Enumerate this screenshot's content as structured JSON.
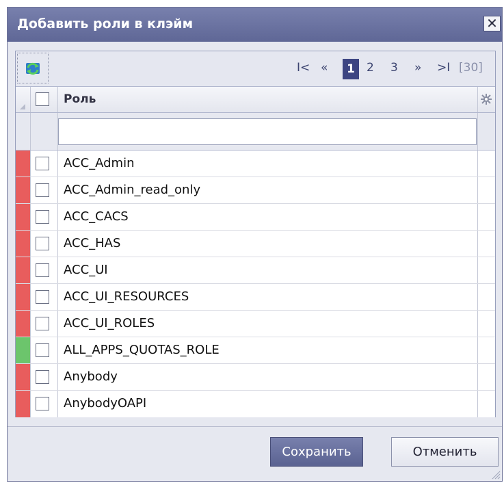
{
  "dialog": {
    "title": "Добавить роли в клэйм",
    "close_glyph": "✕"
  },
  "toolbar": {
    "refresh_icon": "refresh-icon",
    "pager": {
      "first": "I<",
      "prev": "«",
      "pages": [
        "1",
        "2",
        "3"
      ],
      "current_page": "1",
      "next": "»",
      "last": ">I",
      "total": "[30]"
    }
  },
  "grid": {
    "column_title": "Роль",
    "filter_value": "",
    "rows": [
      {
        "label": "ACC_Admin",
        "status_color": "#e85d5d"
      },
      {
        "label": "ACC_Admin_read_only",
        "status_color": "#e85d5d"
      },
      {
        "label": "ACC_CACS",
        "status_color": "#e85d5d"
      },
      {
        "label": "ACC_HAS",
        "status_color": "#e85d5d"
      },
      {
        "label": "ACC_UI",
        "status_color": "#e85d5d"
      },
      {
        "label": "ACC_UI_RESOURCES",
        "status_color": "#e85d5d"
      },
      {
        "label": "ACC_UI_ROLES",
        "status_color": "#e85d5d"
      },
      {
        "label": "ALL_APPS_QUOTAS_ROLE",
        "status_color": "#6cc56c"
      },
      {
        "label": "Anybody",
        "status_color": "#e85d5d"
      },
      {
        "label": "AnybodyOAPI",
        "status_color": "#e85d5d"
      }
    ]
  },
  "buttons": {
    "save": "Сохранить",
    "cancel": "Отменить"
  },
  "colors": {
    "titlebar": "#6870a0",
    "accent": "#3d4582",
    "error_status": "#e85d5d",
    "ok_status": "#6cc56c"
  }
}
